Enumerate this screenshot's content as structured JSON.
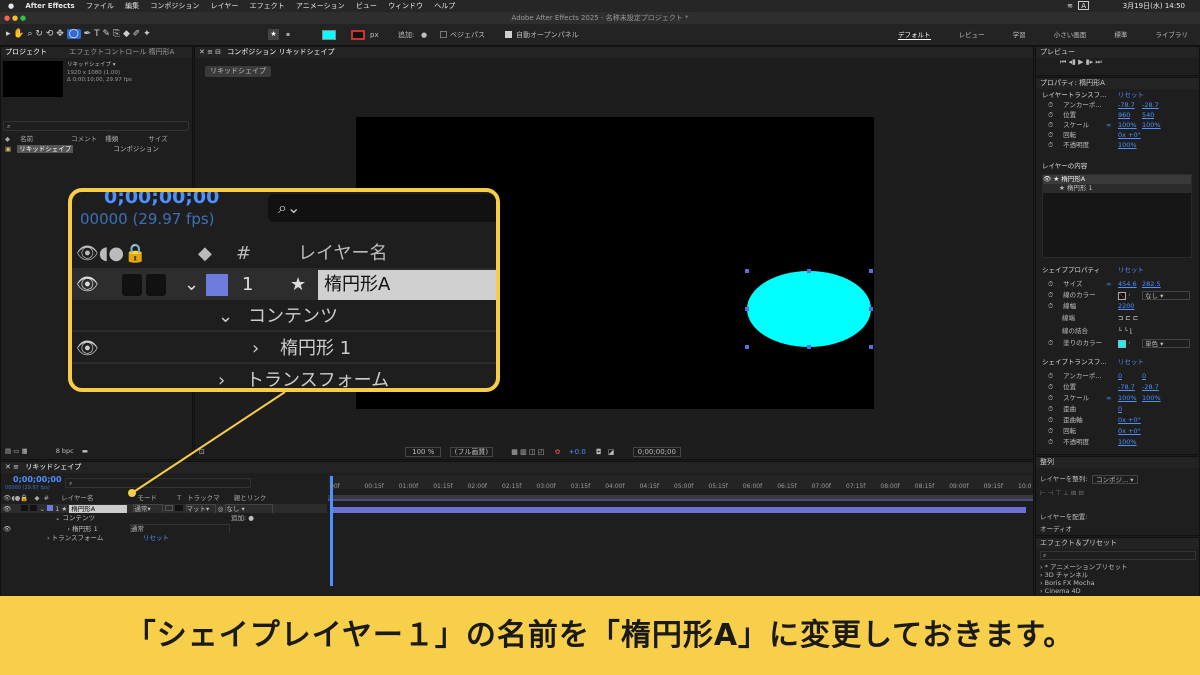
{
  "menubar": {
    "app": "After Effects",
    "items": [
      "ファイル",
      "編集",
      "コンポジション",
      "レイヤー",
      "エフェクト",
      "アニメーション",
      "ビュー",
      "ウィンドウ",
      "ヘルプ"
    ],
    "clock": "3月19日(水) 14:50",
    "input_indicator": "A"
  },
  "window_title": "Adobe After Effects 2025 - 名称未設定プロジェクト *",
  "toolbar": {
    "px_label": "px",
    "add_label": "追加:",
    "bezier_label": "ベジェパス",
    "auto_open_label": "自動オープンパネル",
    "workspaces": [
      "デフォルト",
      "レビュー",
      "学習",
      "小さい画面",
      "標準",
      "ライブラリ"
    ],
    "active_workspace": "デフォルト"
  },
  "project_panel": {
    "tab_project": "プロジェクト",
    "tab_effect_controls": "エフェクトコントロール 楕円形A",
    "thumb_name": "リキッドシェイプ ▾",
    "thumb_info1": "1920 x 1080 (1.00)",
    "thumb_info2": "Δ 0;00;10;00, 29.97 fps",
    "col_name": "名前",
    "col_comment": "コメント",
    "col_type": "種類",
    "col_size": "サイズ",
    "item_name": "リキッドシェイプ",
    "item_type": "コンポジション",
    "bpc": "8 bpc"
  },
  "comp_panel": {
    "tab": "コンポジション リキッドシェイプ",
    "breadcrumb": "リキッドシェイプ",
    "zoom": "100 %",
    "resolution": "(フル画質)",
    "exposure": "+0.0",
    "timecode": "0;00;00;00",
    "shape_color": "#00ffff"
  },
  "timeline": {
    "tab": "リキッドシェイプ",
    "timecode": "0;00;00;00",
    "frames": "00000 (29.97 fps)",
    "col_layer_name": "レイヤー名",
    "col_mode": "モード",
    "col_t": "T",
    "col_trackmatte": "トラックマ",
    "col_parent": "親とリンク",
    "layer_number": "1",
    "layer_name": "楕円形A",
    "layer_mode": "通常",
    "layer_matte": "マット",
    "layer_parent": "なし",
    "contents_label": "コンテンツ",
    "add_label": "追加:",
    "ellipse_label": "楕円形 1",
    "ellipse_mode": "通常",
    "transform_label": "トランスフォーム",
    "reset_label": "リセット",
    "ruler": [
      "00f",
      "00:15f",
      "01:00f",
      "01:15f",
      "02:00f",
      "02:15f",
      "03:00f",
      "03:15f",
      "04:00f",
      "04:15f",
      "05:00f",
      "05:15f",
      "06:00f",
      "06:15f",
      "07:00f",
      "07:15f",
      "08:00f",
      "08:15f",
      "09:00f",
      "09:15f",
      "10:0"
    ]
  },
  "zoom_callout": {
    "timecode": "0;00;00;00",
    "frames": "00000 (29.97 fps)",
    "hash": "#",
    "col_layer_name": "レイヤー名",
    "layer_number": "1",
    "layer_name": "楕円形A",
    "contents": "コンテンツ",
    "ellipse": "楕円形 1",
    "transform": "トランスフォーム"
  },
  "preview_panel": {
    "title": "プレビュー"
  },
  "properties_panel": {
    "title": "プロパティ: 楕円形A",
    "layer_transform": "レイヤートランスフ...",
    "reset": "リセット",
    "anchor": "アンカーポ...",
    "anchor_x": "-78.7",
    "anchor_y": "-28.7",
    "position": "位置",
    "pos_x": "960",
    "pos_y": "540",
    "scale": "スケール",
    "scale_x": "100%",
    "scale_y": "100%",
    "rotation": "回転",
    "rotation_val": "0x +0°",
    "opacity": "不透明度",
    "opacity_val": "100%",
    "layer_contents": "レイヤーの内容",
    "contents_layer": "楕円形A",
    "contents_ellipse": "楕円形 1",
    "shape_props": "シェイププロパティ",
    "size": "サイズ",
    "size_x": "454.6",
    "size_y": "282.5",
    "stroke_color": "線のカラー",
    "stroke_none": "なし",
    "stroke_width": "線幅",
    "stroke_width_val": "2200",
    "stroke_cap": "線端",
    "stroke_join": "線の結合",
    "fill_color": "塗りのカラー",
    "fill_mode": "単色",
    "shape_transform": "シェイプトランスフ...",
    "s_anchor_x": "0",
    "s_anchor_y": "0",
    "s_pos_x": "-78.7",
    "s_pos_y": "-28.7",
    "s_scale_x": "100%",
    "s_scale_y": "100%",
    "skew": "歪曲",
    "skew_val": "0",
    "skew_axis": "歪曲軸",
    "skew_axis_val": "0x +0°",
    "s_rotation_val": "0x +0°",
    "s_opacity_val": "100%"
  },
  "align_panel": {
    "title": "整列",
    "align_to_label": "レイヤーを整列:",
    "align_to_value": "コンポジ...",
    "distribute": "レイヤーを配置:",
    "audio": "オーディオ"
  },
  "effects_panel": {
    "title": "エフェクト＆プリセット",
    "items": [
      "* アニメーションプリセット",
      "3D チャンネル",
      "Boris FX Mocha",
      "Cinema 4D"
    ]
  },
  "caption": "「シェイプレイヤー１」の名前を「楕円形A」に変更しておきます。"
}
